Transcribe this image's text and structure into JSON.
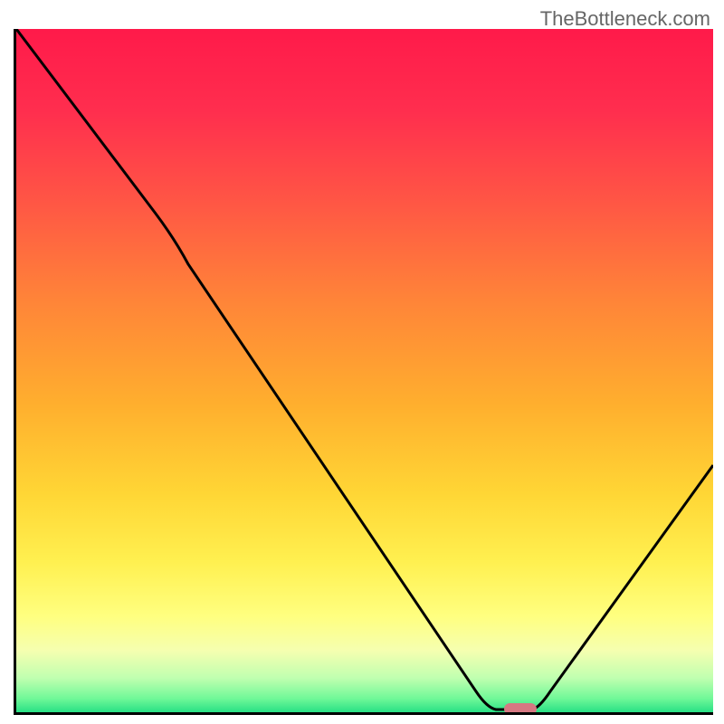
{
  "watermark": "TheBottleneck.com",
  "chart_data": {
    "type": "line",
    "title": "",
    "xlabel": "",
    "ylabel": "",
    "description": "Bottleneck percentage curve over gradient heatmap background",
    "x_range": [
      0,
      100
    ],
    "y_range": [
      0,
      100
    ],
    "curve_points": [
      {
        "x": 0,
        "y": 100
      },
      {
        "x": 20,
        "y": 73
      },
      {
        "x": 24,
        "y": 68
      },
      {
        "x": 66,
        "y": 3
      },
      {
        "x": 68,
        "y": 0
      },
      {
        "x": 74,
        "y": 0
      },
      {
        "x": 100,
        "y": 36
      }
    ],
    "optimal_zone": {
      "x": 72,
      "y": 0,
      "width": 5
    },
    "gradient_stops": [
      {
        "offset": 0,
        "color": "#ff1744"
      },
      {
        "offset": 15,
        "color": "#ff3850"
      },
      {
        "offset": 35,
        "color": "#ff7b3d"
      },
      {
        "offset": 55,
        "color": "#ffb030"
      },
      {
        "offset": 72,
        "color": "#ffe040"
      },
      {
        "offset": 85,
        "color": "#ffff70"
      },
      {
        "offset": 93,
        "color": "#e0ffb0"
      },
      {
        "offset": 98,
        "color": "#80ff90"
      },
      {
        "offset": 100,
        "color": "#30e080"
      }
    ]
  }
}
